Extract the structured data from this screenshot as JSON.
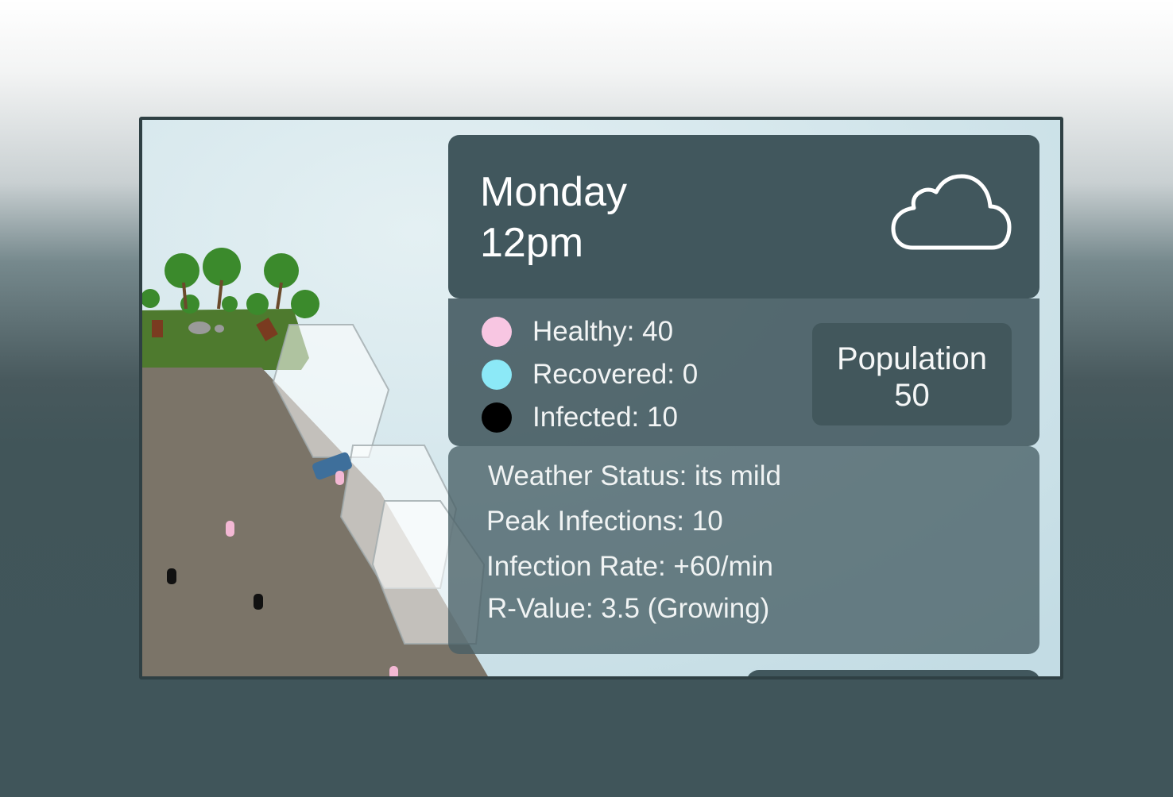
{
  "clock": {
    "day": "Monday",
    "time": "12pm"
  },
  "weather_icon": "cloud-icon",
  "legend": [
    {
      "label": "Healthy: 40",
      "color": "#f8c6e2"
    },
    {
      "label": "Recovered: 0",
      "color": "#8ce9f7"
    },
    {
      "label": "Infected: 10",
      "color": "#000000"
    }
  ],
  "population": {
    "label": "Population",
    "value": "50"
  },
  "stats": {
    "weather_status": "Weather Status: its mild",
    "peak_infections": "Peak Infections: 10",
    "infection_rate": "Infection Rate: +60/min",
    "r_value": "R-Value: 3.5 (Growing)"
  },
  "colors": {
    "panel": "#41575d",
    "page_background": "#40555a"
  }
}
